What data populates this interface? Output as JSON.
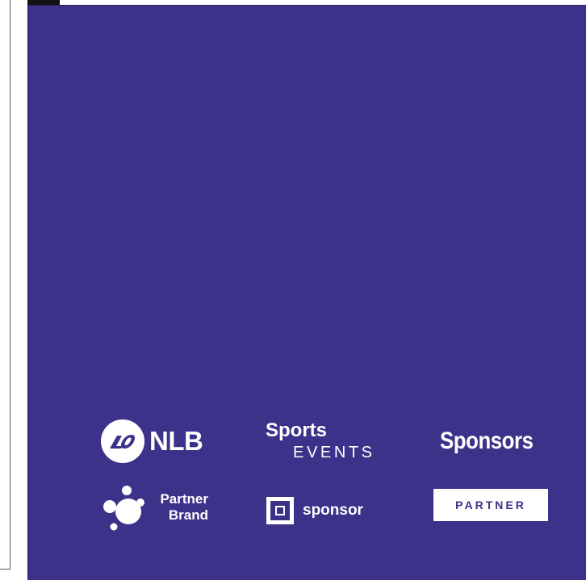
{
  "colors": {
    "panel_background": "#3c3289",
    "logo_foreground": "#ffffff",
    "page_background": "#ffffff"
  },
  "sponsor_logos": {
    "nlb": {
      "icon": "nlb-circle-logo-icon",
      "text": "NLB"
    },
    "sports_events": {
      "line1": "Sports",
      "line2": "EVENTS"
    },
    "sponsors": {
      "text": "Sponsors"
    },
    "partner_brand": {
      "icon": "partner-brand-dots-icon",
      "line1": "Partner",
      "line2": "Brand"
    },
    "sponsor": {
      "icon": "sponsor-square-icon",
      "text": "sponsor"
    },
    "partner": {
      "text": "PARTNER"
    }
  }
}
